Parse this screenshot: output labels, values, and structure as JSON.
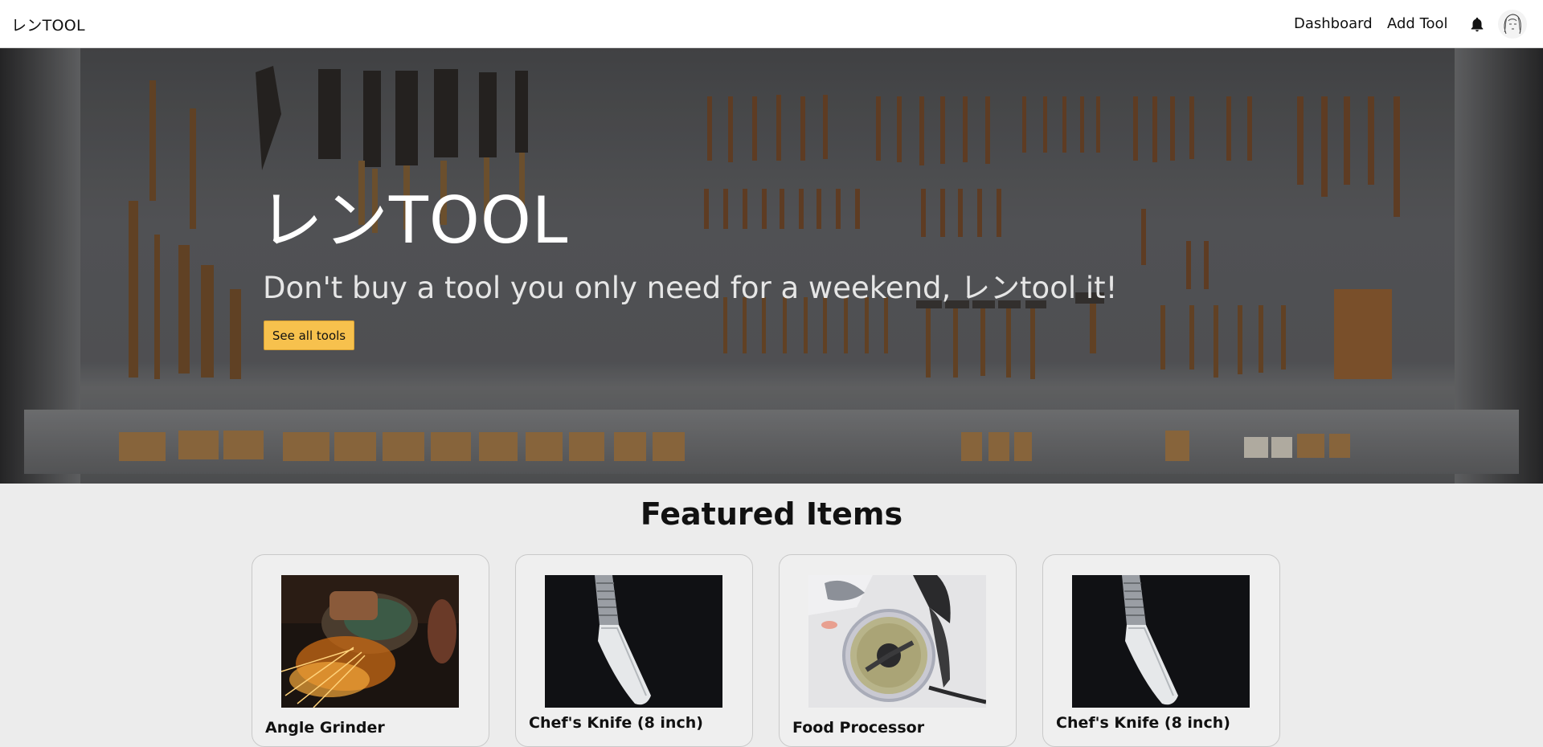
{
  "navbar": {
    "brand": "レンTOOL",
    "links": [
      "Dashboard",
      "Add Tool"
    ],
    "icons": [
      "bell-icon",
      "avatar"
    ]
  },
  "hero": {
    "title": "レンTOOL",
    "tagline": "Don't buy a tool you only need for a weekend, レンtool it!",
    "button_label": "See all tools",
    "button_color": "#f7c14d"
  },
  "featured": {
    "title": "Featured Items",
    "items": [
      {
        "name": "Angle Grinder"
      },
      {
        "name": "Chef's Knife (8 inch)"
      },
      {
        "name": "Food Processor"
      },
      {
        "name": "Chef's Knife (8 inch)"
      }
    ]
  }
}
